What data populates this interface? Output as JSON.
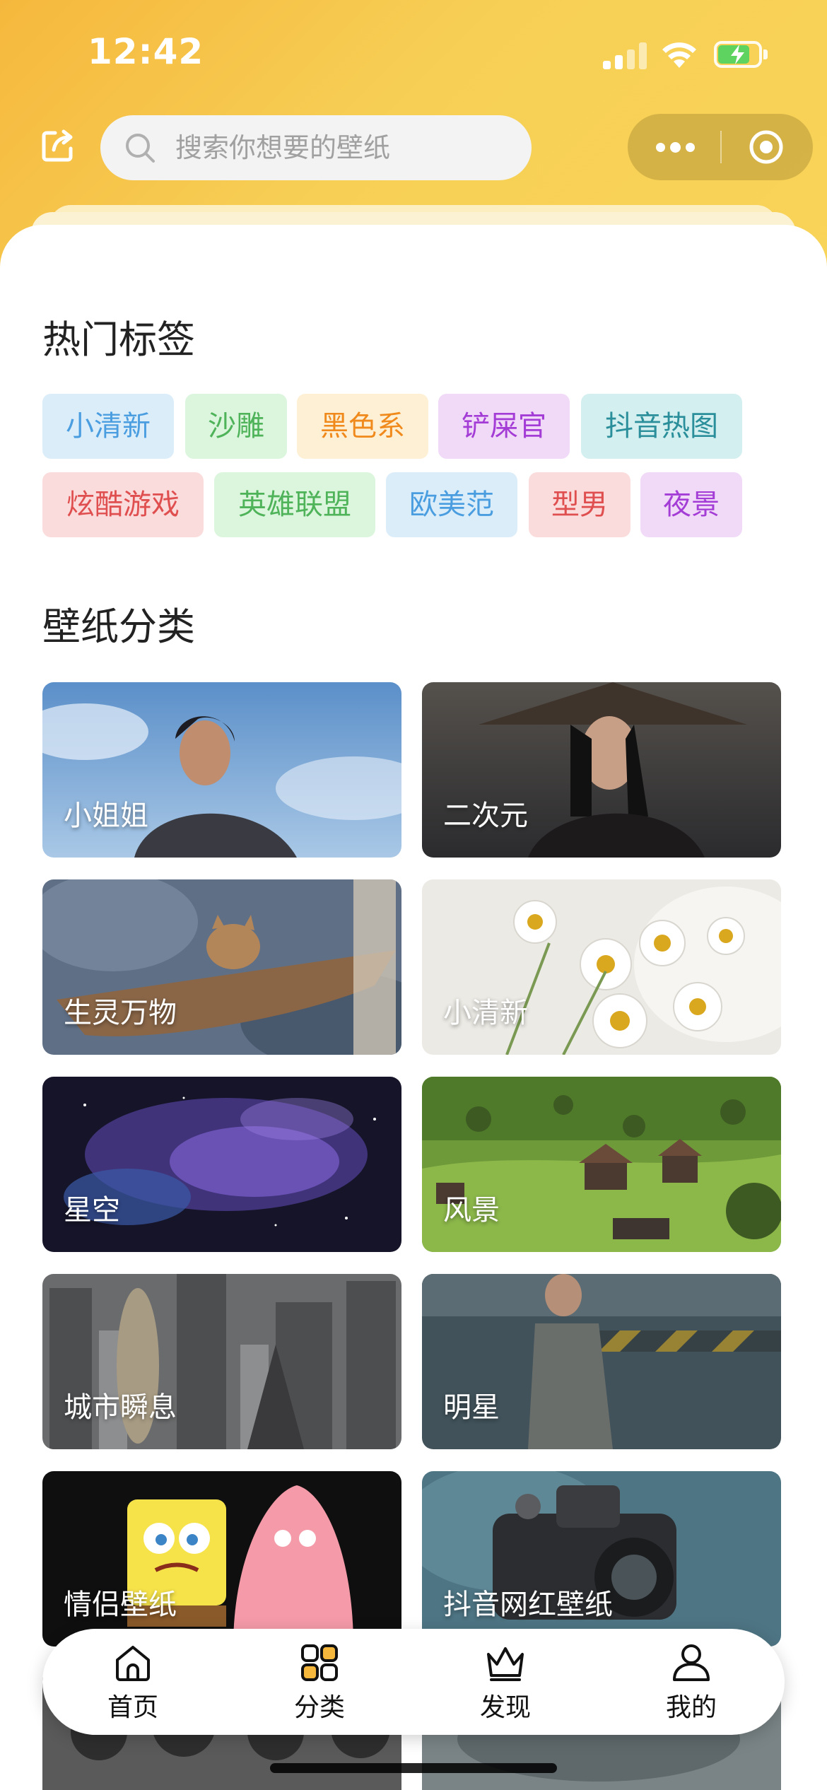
{
  "status_bar": {
    "time": "12:42"
  },
  "header": {
    "search_placeholder": "搜索你想要的壁纸",
    "icons": [
      "share-icon",
      "search-icon",
      "more-icon",
      "close-target-icon"
    ]
  },
  "hot_tags": {
    "title": "热门标签",
    "items": [
      {
        "label": "小清新",
        "color": "#4a9ee0",
        "bg": "#dcedfa"
      },
      {
        "label": "沙雕",
        "color": "#4fb35a",
        "bg": "#dcf5dd"
      },
      {
        "label": "黑色系",
        "color": "#f08a1c",
        "bg": "#fdf0d4"
      },
      {
        "label": "铲屎官",
        "color": "#a43cd6",
        "bg": "#f1d9f8"
      },
      {
        "label": "抖音热图",
        "color": "#2a8f9a",
        "bg": "#d4eff0"
      },
      {
        "label": "炫酷游戏",
        "color": "#e04f4f",
        "bg": "#fbdcdc"
      },
      {
        "label": "英雄联盟",
        "color": "#4fb35a",
        "bg": "#dcf5dd"
      },
      {
        "label": "欧美范",
        "color": "#4a9ee0",
        "bg": "#dcedfa"
      },
      {
        "label": "型男",
        "color": "#e04f4f",
        "bg": "#fbdcdc"
      },
      {
        "label": "夜景",
        "color": "#a43cd6",
        "bg": "#f1d9f8"
      }
    ]
  },
  "categories": {
    "title": "壁纸分类",
    "items": [
      {
        "label": "小姐姐"
      },
      {
        "label": "二次元"
      },
      {
        "label": "生灵万物"
      },
      {
        "label": "小清新"
      },
      {
        "label": "星空"
      },
      {
        "label": "风景"
      },
      {
        "label": "城市瞬息"
      },
      {
        "label": "明星"
      },
      {
        "label": "情侣壁纸"
      },
      {
        "label": "抖音网红壁纸"
      }
    ]
  },
  "tabbar": {
    "items": [
      {
        "label": "首页",
        "icon": "home-icon"
      },
      {
        "label": "分类",
        "icon": "grid-icon"
      },
      {
        "label": "发现",
        "icon": "crown-icon"
      },
      {
        "label": "我的",
        "icon": "user-icon"
      }
    ]
  },
  "colors": {
    "header_yellow": "#f7cf55",
    "header_orange": "#f5b83d"
  }
}
